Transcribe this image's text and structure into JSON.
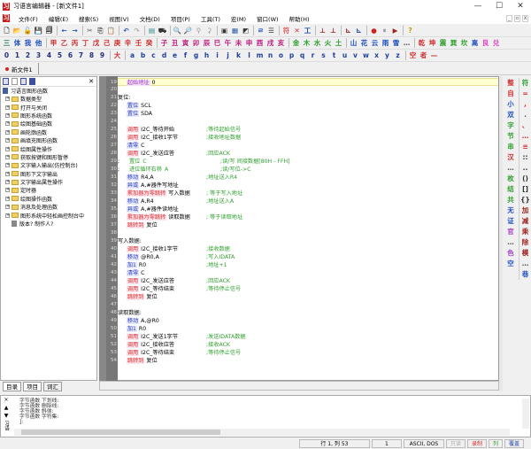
{
  "window": {
    "title": "习语言编辑器 - [新文件1]",
    "app_icon": "习",
    "controls": [
      "—",
      "☐",
      "✕"
    ]
  },
  "menu": [
    "文件(F)",
    "编辑(E)",
    "搜索(S)",
    "视图(V)",
    "文档(D)",
    "项目(P)",
    "工具(T)",
    "宏(M)",
    "窗口(W)",
    "帮助(H)"
  ],
  "mdi_controls": [
    "_",
    "▫",
    "x"
  ],
  "toolbar1": [
    [
      "🗋",
      "#333"
    ],
    [
      "📂",
      "#c90"
    ],
    [
      "🔓",
      "#c90"
    ],
    [
      "💾",
      "#333"
    ],
    [
      "🗐",
      "#333"
    ],
    [
      "|",
      ""
    ],
    [
      "←",
      "#2050c0"
    ],
    [
      "→",
      "#2050c0"
    ],
    [
      "|",
      ""
    ],
    [
      "✂",
      "#555"
    ],
    [
      "⎘",
      "#555"
    ],
    [
      "📋",
      "#a07020"
    ],
    [
      "|",
      ""
    ],
    [
      "↶",
      "#2050c0"
    ],
    [
      "↷",
      "#aaa"
    ],
    [
      "|",
      ""
    ],
    [
      "▤",
      "#208080"
    ],
    [
      "⛟",
      "#333"
    ],
    [
      "|",
      ""
    ],
    [
      "🔍",
      "#333"
    ],
    [
      "🔎",
      "#a04020"
    ],
    [
      "⚲",
      "#999"
    ],
    [
      "⚳",
      "#999"
    ],
    [
      "|",
      ""
    ],
    [
      "▣",
      "#333"
    ],
    [
      "▦",
      "#2050a0"
    ],
    [
      "◩",
      "#333"
    ],
    [
      "|",
      ""
    ],
    [
      "ㄹ",
      "#2050c0"
    ],
    [
      "☰",
      "#333"
    ],
    [
      "|",
      ""
    ],
    [
      "符",
      "#e06060"
    ],
    [
      "✕",
      "#d03030"
    ],
    [
      "工",
      "#2050a0"
    ],
    [
      "|",
      ""
    ],
    [
      "⊥",
      "#a02020"
    ],
    [
      "⊥",
      "#a02020"
    ],
    [
      "|",
      ""
    ],
    [
      "⊾",
      "#a02020"
    ],
    [
      "⊾",
      "#2040a0"
    ],
    [
      "|",
      ""
    ],
    [
      "●",
      "#d02020"
    ],
    [
      "⏸",
      "#999"
    ],
    [
      "▶",
      "#a02020"
    ],
    [
      "|",
      ""
    ],
    [
      "?",
      "#c0a000"
    ]
  ],
  "toolbar2": [
    [
      "三",
      "#208060"
    ],
    [
      "体",
      "#2050c0"
    ],
    [
      "我",
      "#2050c0"
    ],
    [
      "他",
      "#2050c0"
    ],
    [
      "|",
      ""
    ],
    [
      "甲",
      "#d03030"
    ],
    [
      "乙",
      "#d03030"
    ],
    [
      "丙",
      "#d03030"
    ],
    [
      "丁",
      "#d03030"
    ],
    [
      "戊",
      "#d03030"
    ],
    [
      "己",
      "#d03030"
    ],
    [
      "庚",
      "#d03030"
    ],
    [
      "辛",
      "#d03030"
    ],
    [
      "壬",
      "#d03030"
    ],
    [
      "癸",
      "#d03030"
    ],
    [
      "|",
      ""
    ],
    [
      "子",
      "#c02080"
    ],
    [
      "丑",
      "#c02080"
    ],
    [
      "寅",
      "#c02080"
    ],
    [
      "卯",
      "#c02080"
    ],
    [
      "辰",
      "#c02080"
    ],
    [
      "巳",
      "#c02080"
    ],
    [
      "午",
      "#c02080"
    ],
    [
      "未",
      "#c02080"
    ],
    [
      "申",
      "#c02080"
    ],
    [
      "酉",
      "#c02080"
    ],
    [
      "戌",
      "#c02080"
    ],
    [
      "亥",
      "#c02080"
    ],
    [
      "|",
      ""
    ],
    [
      "金",
      "#30a030"
    ],
    [
      "木",
      "#30a030"
    ],
    [
      "水",
      "#30a030"
    ],
    [
      "火",
      "#30a030"
    ],
    [
      "土",
      "#30a030"
    ],
    [
      "|",
      ""
    ],
    [
      "山",
      "#2050c0"
    ],
    [
      "花",
      "#2050c0"
    ],
    [
      "云",
      "#2050c0"
    ],
    [
      "雨",
      "#2050c0"
    ],
    [
      "雪",
      "#2050c0"
    ],
    [
      "…",
      "#555"
    ],
    [
      "|",
      ""
    ],
    [
      "乾",
      "#d03030"
    ],
    [
      "坤",
      "#d03030"
    ],
    [
      "震",
      "#30a030"
    ],
    [
      "巽",
      "#30a030"
    ],
    [
      "坎",
      "#30a030"
    ],
    [
      "离",
      "#2050c0"
    ],
    [
      "艮",
      "#e040c0"
    ],
    [
      "兑",
      "#e040c0"
    ]
  ],
  "toolbar3": [
    [
      "0",
      "#203080"
    ],
    [
      "1",
      "#203080"
    ],
    [
      "2",
      "#203080"
    ],
    [
      "3",
      "#203080"
    ],
    [
      "4",
      "#203080"
    ],
    [
      "5",
      "#203080"
    ],
    [
      "6",
      "#203080"
    ],
    [
      "7",
      "#203080"
    ],
    [
      "8",
      "#203080"
    ],
    [
      "9",
      "#203080"
    ],
    [
      "|",
      ""
    ],
    [
      "大",
      "#d03030"
    ],
    [
      "|",
      ""
    ],
    [
      "a",
      "#2040a0"
    ],
    [
      "b",
      "#2040a0"
    ],
    [
      "c",
      "#2040a0"
    ],
    [
      "d",
      "#2040a0"
    ],
    [
      "e",
      "#2040a0"
    ],
    [
      "f",
      "#2040a0"
    ],
    [
      "g",
      "#2040a0"
    ],
    [
      "h",
      "#2040a0"
    ],
    [
      "i",
      "#2040a0"
    ],
    [
      "j",
      "#2040a0"
    ],
    [
      "k",
      "#2040a0"
    ],
    [
      "l",
      "#2040a0"
    ],
    [
      "m",
      "#2040a0"
    ],
    [
      "n",
      "#2040a0"
    ],
    [
      "o",
      "#2040a0"
    ],
    [
      "p",
      "#2040a0"
    ],
    [
      "q",
      "#2040a0"
    ],
    [
      "r",
      "#2040a0"
    ],
    [
      "s",
      "#2040a0"
    ],
    [
      "t",
      "#2040a0"
    ],
    [
      "u",
      "#2040a0"
    ],
    [
      "v",
      "#2040a0"
    ],
    [
      "w",
      "#2040a0"
    ],
    [
      "x",
      "#2040a0"
    ],
    [
      "y",
      "#2040a0"
    ],
    [
      "z",
      "#2040a0"
    ],
    [
      "|",
      ""
    ],
    [
      "空",
      "#d03030"
    ],
    [
      "者",
      "#d03030"
    ],
    [
      "—",
      "#d03030"
    ]
  ],
  "tabs": {
    "active": "新文件1"
  },
  "left_panel": {
    "root": "习语言图形函数",
    "folders": [
      "数据类型",
      "打开与关闭",
      "图形系统函数",
      "绘图基础函数",
      "画轮廓函数",
      "画填充图形函数",
      "绘图属性操作",
      "获取按键和图形暂停",
      "文字输入输出(仿控制台)",
      "图形下文字输出",
      "文字输出属性操作",
      "定时器",
      "绘图操作函数",
      "消息及处理函数",
      "图形系统中轻松画控制台中"
    ],
    "doc_item": "版本? 制作人?",
    "tabs": [
      "目录",
      "项目",
      "词汇"
    ]
  },
  "code": [
    {
      "n": 19,
      "kw": "起始地址",
      "c": "mag",
      "arg": " 0",
      "cur": true,
      "ind": 1
    },
    {
      "n": 20
    },
    {
      "n": 21,
      "label": "复位:"
    },
    {
      "n": 22,
      "kw": "置位",
      "c": "blue",
      "arg": " SCL",
      "ind": 1
    },
    {
      "n": 23,
      "kw": "置位",
      "c": "blue",
      "arg": " SDA",
      "ind": 1
    },
    {
      "n": 24
    },
    {
      "n": 25,
      "kw": "调用",
      "c": "red",
      "arg": " I2C_等待开始",
      "cm": ";等待起始信号",
      "ind": 1
    },
    {
      "n": 26,
      "kw": "调用",
      "c": "red",
      "arg": " I2C_接收1字节",
      "cm": ";接收地址数据",
      "ind": 1
    },
    {
      "n": 27,
      "kw": "清零",
      "c": "blue",
      "arg": " C",
      "ind": 1
    },
    {
      "n": 28,
      "kw": "调用",
      "c": "red",
      "arg": " I2C_发送应答",
      "cm": ";回应ACK",
      "ind": 1
    },
    {
      "n": 29,
      "label": ";",
      "kw": "置位",
      "c": "green",
      "arg": " C",
      "cm": ";读/写 间接数据[80H - FFH]",
      "ind": 2
    },
    {
      "n": 30,
      "label": ";",
      "kw": "进位循环右移",
      "c": "green",
      "arg": " A",
      "cm": ";读/写位->C",
      "ind": 2
    },
    {
      "n": 31,
      "kw": "移动",
      "c": "blue",
      "arg": " R4,A",
      "cm": ";地址送入R4",
      "ind": 1
    },
    {
      "n": 32,
      "kw": "异或",
      "c": "blue",
      "arg": " A,#器件写地址",
      "ind": 1
    },
    {
      "n": 33,
      "kw": "累加器为零跳转",
      "c": "red",
      "arg": " 写入数据",
      "cm": "; 等于写入地址",
      "ind": 1
    },
    {
      "n": 34,
      "kw": "移动",
      "c": "blue",
      "arg": " A,R4",
      "cm": ";地址送入A",
      "ind": 1
    },
    {
      "n": 35,
      "kw": "异或",
      "c": "blue",
      "arg": " A,#器件读地址",
      "ind": 1
    },
    {
      "n": 36,
      "kw": "累加器为零跳转",
      "c": "red",
      "arg": " 读取数据",
      "cm": "; 等于读取地址",
      "ind": 1
    },
    {
      "n": 37,
      "kw": "跳转到",
      "c": "red",
      "arg": " 复位",
      "ind": 1
    },
    {
      "n": 38
    },
    {
      "n": 39,
      "label": "写入数据:"
    },
    {
      "n": 40,
      "kw": "调用",
      "c": "red",
      "arg": " I2C_接收1字节",
      "cm": ";接收数据",
      "ind": 1
    },
    {
      "n": 41,
      "kw": "移动",
      "c": "blue",
      "arg": " @R0,A",
      "cm": ";写入IDATA",
      "ind": 1
    },
    {
      "n": 42,
      "kw": "加1",
      "c": "blue",
      "arg": " R0",
      "cm": ";地址+1",
      "ind": 1
    },
    {
      "n": 43,
      "kw": "清零",
      "c": "blue",
      "arg": " C",
      "ind": 1
    },
    {
      "n": 44,
      "kw": "调用",
      "c": "red",
      "arg": " I2C_发送应答",
      "cm": ";回应ACK",
      "ind": 1
    },
    {
      "n": 45,
      "kw": "调用",
      "c": "red",
      "arg": " I2C_等待结束",
      "cm": ";等待停止信号",
      "ind": 1
    },
    {
      "n": 46,
      "kw": "跳转到",
      "c": "red",
      "arg": " 复位",
      "ind": 1
    },
    {
      "n": 47
    },
    {
      "n": 48,
      "label": "读取数据:"
    },
    {
      "n": 49,
      "kw": "移动",
      "c": "blue",
      "arg": " A,@R0",
      "ind": 1
    },
    {
      "n": 50,
      "kw": "加1",
      "c": "blue",
      "arg": " R0",
      "ind": 1
    },
    {
      "n": 51,
      "kw": "调用",
      "c": "red",
      "arg": " I2C_发送1字节",
      "cm": ";发送IDATA数据",
      "ind": 1
    },
    {
      "n": 52,
      "kw": "调用",
      "c": "red",
      "arg": " I2C_接收应答",
      "cm": ";接收ACK",
      "ind": 1
    },
    {
      "n": 53,
      "kw": "调用",
      "c": "red",
      "arg": " I2C_等待结束",
      "cm": ";等待停止信号",
      "ind": 1
    },
    {
      "n": 54,
      "kw": "跳转到",
      "c": "red",
      "arg": " 复位",
      "ind": 1
    }
  ],
  "side1": [
    [
      "整",
      "#d03030"
    ],
    [
      "自",
      "#d03030"
    ],
    [
      "小",
      "#2050c0"
    ],
    [
      "双",
      "#2050c0"
    ],
    [
      "字",
      "#30a030"
    ],
    [
      "节",
      "#30a030"
    ],
    [
      "串",
      "#30a030"
    ],
    [
      "汉",
      "#d03030"
    ],
    [
      "…",
      "#555"
    ],
    [
      "枚",
      "#30a030"
    ],
    [
      "结",
      "#30a030"
    ],
    [
      "共",
      "#30a030"
    ],
    [
      "无",
      "#2050c0"
    ],
    [
      "证",
      "#2050c0"
    ],
    [
      "官",
      "#a040c0"
    ],
    [
      "…",
      "#555"
    ],
    [
      "色",
      "#a040c0"
    ],
    [
      "空",
      "#2050c0"
    ]
  ],
  "side2": [
    [
      "符",
      "#30a030"
    ],
    [
      "=",
      "#d03030"
    ],
    [
      ",",
      "#d03030"
    ],
    [
      ".",
      "#555"
    ],
    [
      "、",
      "#d03030"
    ],
    [
      "…",
      "#d03030"
    ],
    [
      "≡",
      "#d03030"
    ],
    [
      "::",
      "#333"
    ],
    [
      "..",
      "#333"
    ],
    [
      "()",
      "#333"
    ],
    [
      "[]",
      "#333"
    ],
    [
      "{}",
      "#333"
    ],
    [
      "加",
      "#a02020"
    ],
    [
      "减",
      "#a02020"
    ],
    [
      "乘",
      "#a02020"
    ],
    [
      "除",
      "#a02020"
    ],
    [
      "模",
      "#a02020"
    ],
    [
      "…",
      "#555"
    ],
    [
      "巷",
      "#2050c0"
    ]
  ],
  "output": {
    "lines": [
      "字节函数 下划线:",
      "字节函数 删除线:",
      "字节函数 斜体:",
      "字节函数 字符集:",
      "]:"
    ],
    "tools": [
      "×",
      "▲",
      "▼",
      "习语"
    ]
  },
  "status": {
    "position": "行 1, 列 53",
    "col2": "1",
    "encoding": "ASCII, DOS",
    "readonly": "只读",
    "record": "录制",
    "column": "列",
    "overwrite": "覆盖"
  }
}
